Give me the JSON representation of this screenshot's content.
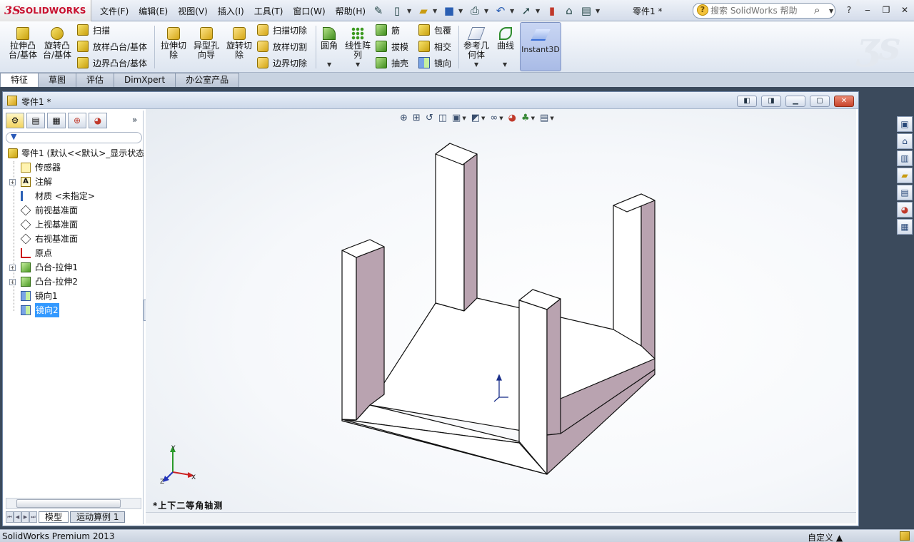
{
  "app": {
    "logo_ds": "3S",
    "logo_brand": "SOLIDWORKS",
    "document_title": "零件1 *",
    "search_placeholder": "搜索 SolidWorks 帮助"
  },
  "menu": [
    "文件(F)",
    "编辑(E)",
    "视图(V)",
    "插入(I)",
    "工具(T)",
    "窗口(W)",
    "帮助(H)"
  ],
  "ribbon": {
    "extrude_boss": "拉伸凸\n台/基体",
    "revolve_boss": "旋转凸\n台/基体",
    "sweep": "扫描",
    "loft_boss": "放样凸台/基体",
    "boundary_boss": "边界凸台/基体",
    "extrude_cut": "拉伸切\n除",
    "hole_wizard": "异型孔\n向导",
    "revolve_cut": "旋转切\n除",
    "sweep_cut": "扫描切除",
    "loft_cut": "放样切割",
    "boundary_cut": "边界切除",
    "fillet": "圆角",
    "linear_pattern": "线性阵\n列",
    "rib": "筋",
    "draft": "拔模",
    "shell": "抽壳",
    "wrap": "包覆",
    "intersect": "相交",
    "mirror": "镜向",
    "ref_geometry": "参考几\n何体",
    "curves": "曲线",
    "instant3d": "Instant3D"
  },
  "cm_tabs": [
    "特征",
    "草图",
    "评估",
    "DimXpert",
    "办公室产品"
  ],
  "doc_window": {
    "title": "零件1 *"
  },
  "tree": {
    "root": "零件1 (默认<<默认>_显示状态",
    "items": [
      {
        "label": "传感器",
        "icon": "sensor-icon",
        "expandable": false
      },
      {
        "label": "注解",
        "icon": "annotation-icon",
        "expandable": true
      },
      {
        "label": "材质 <未指定>",
        "icon": "material-icon",
        "expandable": false
      },
      {
        "label": "前视基准面",
        "icon": "plane-icon",
        "expandable": false
      },
      {
        "label": "上视基准面",
        "icon": "plane-icon",
        "expandable": false
      },
      {
        "label": "右视基准面",
        "icon": "plane-icon",
        "expandable": false
      },
      {
        "label": "原点",
        "icon": "origin-icon",
        "expandable": false
      },
      {
        "label": "凸台-拉伸1",
        "icon": "boss-extrude-icon",
        "expandable": true
      },
      {
        "label": "凸台-拉伸2",
        "icon": "boss-extrude-icon",
        "expandable": true
      },
      {
        "label": "镜向1",
        "icon": "mirror-icon",
        "expandable": false
      },
      {
        "label": "镜向2",
        "icon": "mirror-icon",
        "expandable": false,
        "selected": true
      }
    ]
  },
  "bottom_tabs": [
    "模型",
    "运动算例 1"
  ],
  "viewport": {
    "view_label": "*上下二等角轴测"
  },
  "axis_labels": {
    "x": "X",
    "y": "Y",
    "z": "Z"
  },
  "status": {
    "product": "SolidWorks Premium 2013",
    "units": "自定义 ▲"
  }
}
